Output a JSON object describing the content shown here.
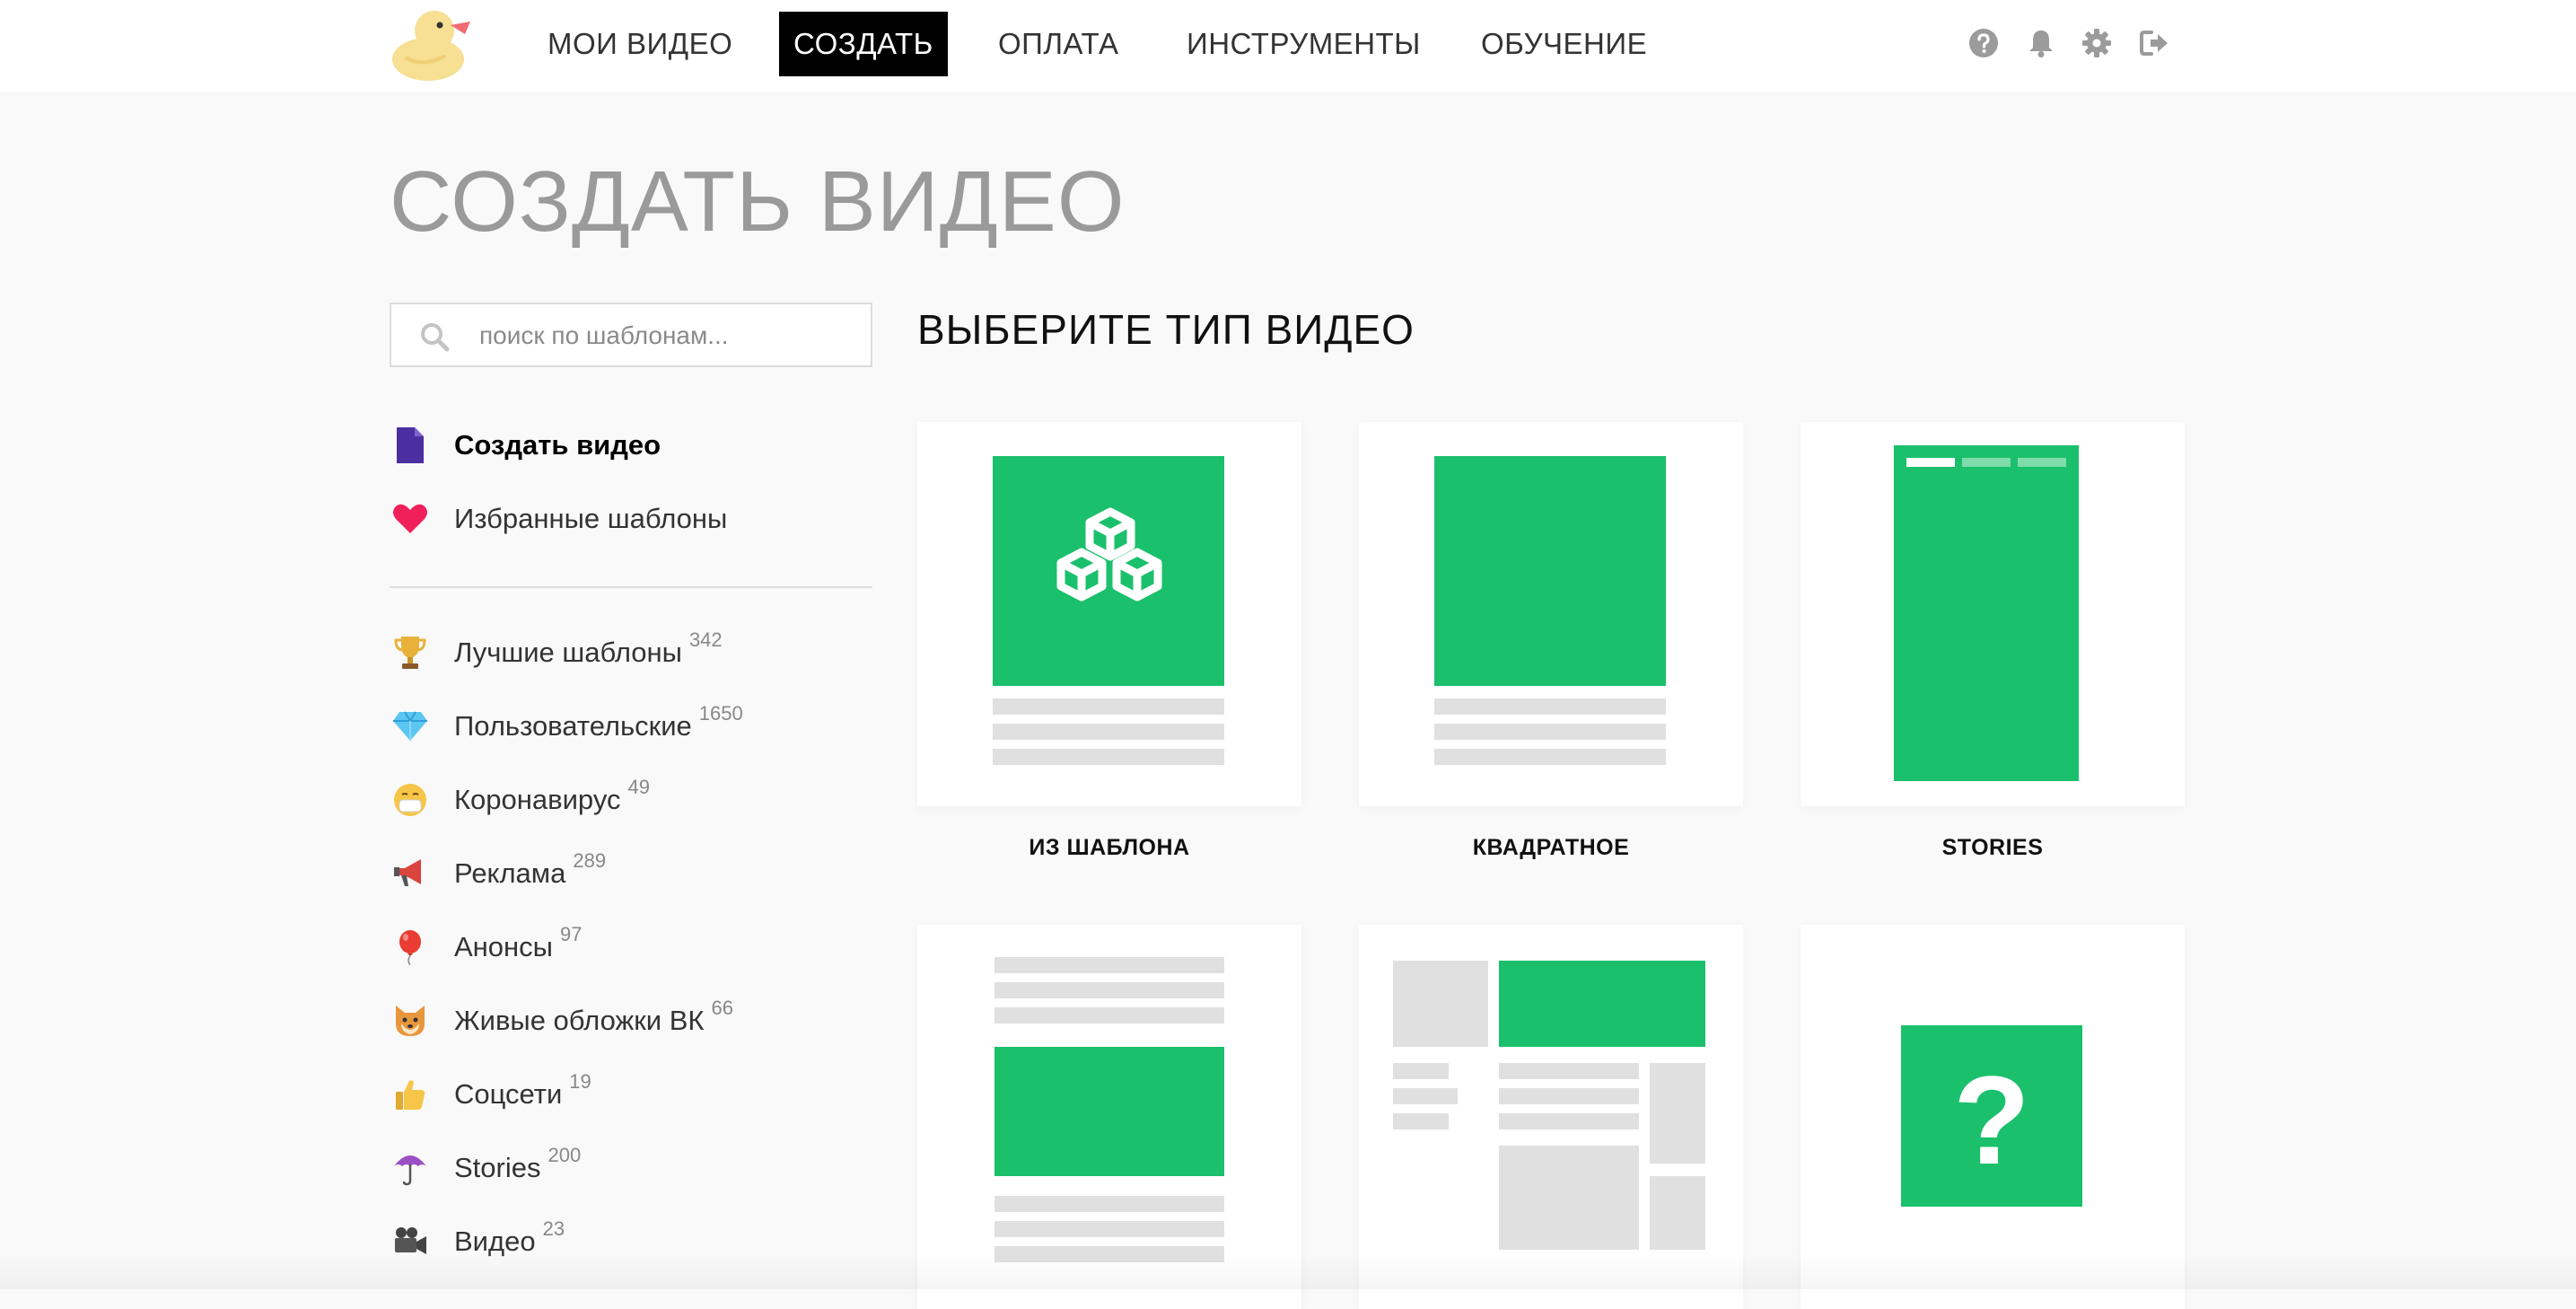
{
  "nav": {
    "items": [
      {
        "label": "МОИ ВИДЕО"
      },
      {
        "label": "СОЗДАТЬ"
      },
      {
        "label": "ОПЛАТА"
      },
      {
        "label": "ИНСТРУМЕНТЫ"
      },
      {
        "label": "ОБУЧЕНИЕ"
      }
    ],
    "active_index": 1,
    "icons": [
      "help-icon",
      "bell-icon",
      "gear-icon",
      "logout-icon"
    ]
  },
  "page": {
    "title": "СОЗДАТЬ ВИДЕО"
  },
  "search": {
    "placeholder": "поиск по шаблонам..."
  },
  "menu": {
    "create_label": "Создать видео",
    "favorites_label": "Избранные шаблоны"
  },
  "categories": [
    {
      "icon": "trophy-icon",
      "label": "Лучшие шаблоны",
      "count": "342"
    },
    {
      "icon": "diamond-icon",
      "label": "Пользовательские",
      "count": "1650"
    },
    {
      "icon": "mask-face-icon",
      "label": "Коронавирус",
      "count": "49"
    },
    {
      "icon": "megaphone-icon",
      "label": "Реклама",
      "count": "289"
    },
    {
      "icon": "balloon-icon",
      "label": "Анонсы",
      "count": "97"
    },
    {
      "icon": "shiba-icon",
      "label": "Живые обложки ВК",
      "count": "66"
    },
    {
      "icon": "thumbs-up-icon",
      "label": "Соцсети",
      "count": "19"
    },
    {
      "icon": "umbrella-icon",
      "label": "Stories",
      "count": "200"
    },
    {
      "icon": "movie-camera-icon",
      "label": "Видео",
      "count": "23"
    }
  ],
  "main": {
    "section_title": "ВЫБЕРИТЕ ТИП ВИДЕО",
    "cards": [
      {
        "label": "ИЗ ШАБЛОНА"
      },
      {
        "label": "КВАДРАТНОЕ"
      },
      {
        "label": "STORIES"
      },
      {
        "label": ""
      },
      {
        "label": ""
      },
      {
        "label": ""
      }
    ],
    "unknown_glyph": "?"
  },
  "colors": {
    "accent_green": "#1bc06c",
    "placeholder_gray": "#e0e0e0",
    "favorite_red": "#f0215a",
    "document_purple": "#4b2fa0"
  }
}
